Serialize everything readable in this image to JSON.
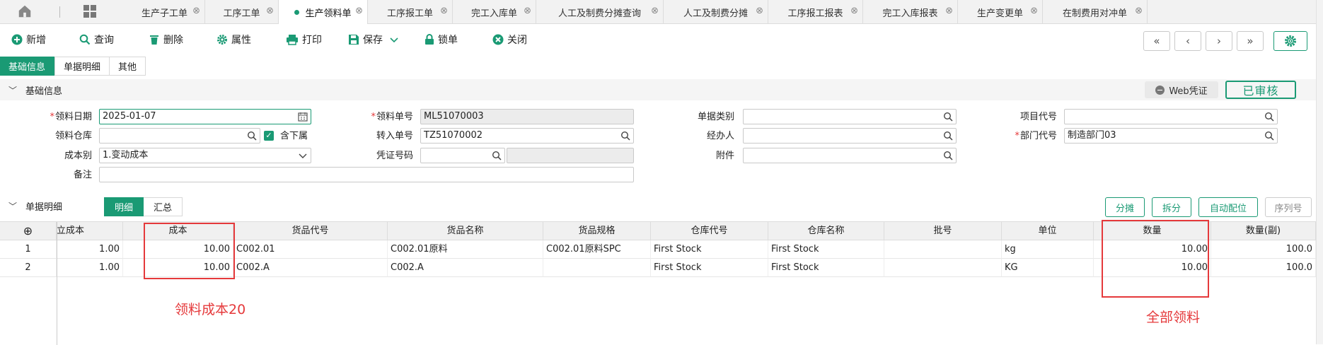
{
  "tabs": [
    {
      "label": "生产子工单"
    },
    {
      "label": "工序工单"
    },
    {
      "label": "生产领料单"
    },
    {
      "label": "工序报工单"
    },
    {
      "label": "完工入库单"
    },
    {
      "label": "人工及制费分摊查询"
    },
    {
      "label": "人工及制费分摊"
    },
    {
      "label": "工序报工报表"
    },
    {
      "label": "完工入库报表"
    },
    {
      "label": "生产变更单"
    },
    {
      "label": "在制费用对冲单"
    }
  ],
  "tab_close_glyph": "⊗",
  "toolbar": {
    "new": "新增",
    "query": "查询",
    "delete": "删除",
    "properties": "属性",
    "print": "打印",
    "save": "保存",
    "lock": "锁单",
    "close": "关闭"
  },
  "nav": {
    "first": "«",
    "prev": "‹",
    "next": "›",
    "last": "»"
  },
  "subtabs": [
    "基础信息",
    "单据明细",
    "其他"
  ],
  "basic_section": {
    "title": "基础信息",
    "web_voucher": "Web凭证",
    "status": "已审核"
  },
  "form": {
    "req_mark": "*",
    "issue_date_label": "领料日期",
    "issue_date": "2025-01-07",
    "warehouse_label": "领料仓库",
    "warehouse": "",
    "include_sub_label": "含下属",
    "cost_type_label": "成本别",
    "cost_type": "1.变动成本",
    "remark_label": "备注",
    "remark": "",
    "issue_no_label": "领料单号",
    "issue_no": "ML51070003",
    "transfer_no_label": "转入单号",
    "transfer_no": "TZ51070002",
    "voucher_no_label": "凭证号码",
    "voucher_no": "",
    "doc_type_label": "单据类别",
    "doc_type": "",
    "handler_label": "经办人",
    "handler": "",
    "attachment_label": "附件",
    "attachment": "",
    "project_label": "项目代号",
    "project": "",
    "dept_label": "部门代号",
    "dept": "制造部门03"
  },
  "detail_section": {
    "title": "单据明细",
    "segments": [
      "明细",
      "汇总"
    ],
    "actions": [
      "分摊",
      "拆分",
      "自动配位",
      "序列号"
    ]
  },
  "table": {
    "add_glyph": "⊕",
    "columns": [
      "立成本",
      "成本",
      "货品代号",
      "货品名称",
      "货品规格",
      "仓库代号",
      "仓库名称",
      "批号",
      "单位",
      "数量",
      "数量(副)"
    ],
    "rows": [
      [
        "1",
        "1.00",
        "10.00",
        "C002.01",
        "C002.01原料",
        "C002.01原料SPC",
        "First Stock",
        "First Stock",
        "",
        "kg",
        "10.00",
        "100.0"
      ],
      [
        "2",
        "1.00",
        "10.00",
        "C002.A",
        "C002.A",
        "",
        "First Stock",
        "First Stock",
        "",
        "KG",
        "10.00",
        "100.0"
      ]
    ]
  },
  "annotations": {
    "cost_note": "领料成本20",
    "qty_note": "全部领料"
  },
  "colors": {
    "accent": "#1a9a74",
    "annotation": "#e5393b"
  }
}
